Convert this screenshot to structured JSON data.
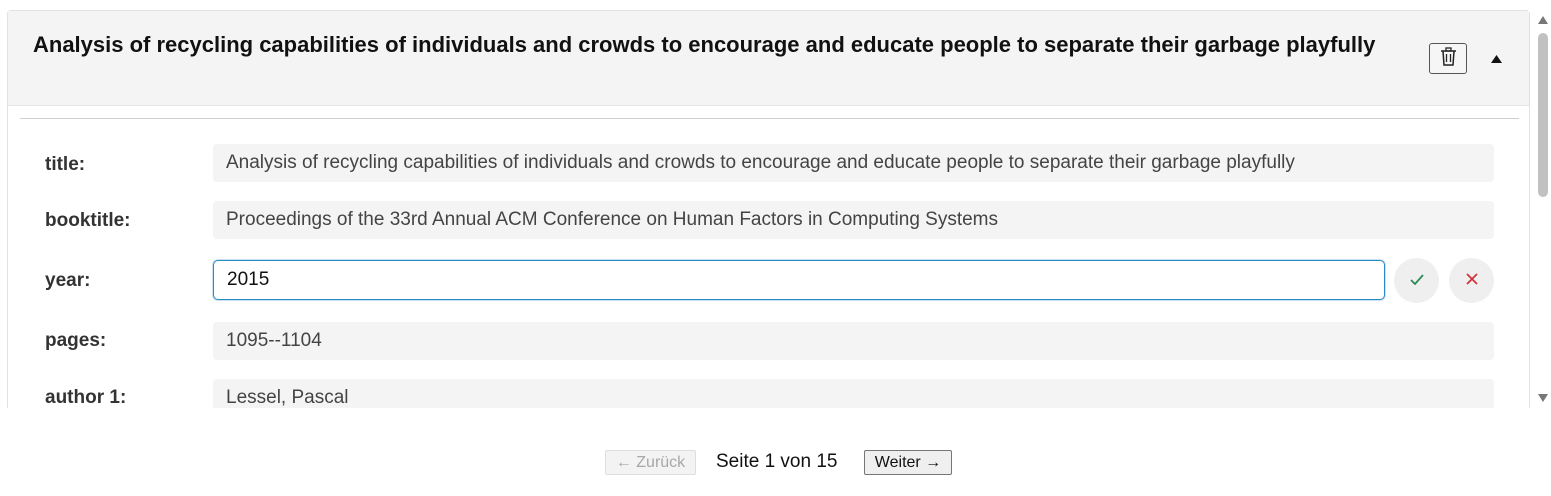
{
  "entry": {
    "title": "Analysis of recycling capabilities of individuals and crowds to encourage and educate people to separate their garbage playfully",
    "delete_icon": "trash-icon",
    "collapse_icon": "triangle-up-icon"
  },
  "fields": {
    "title": {
      "label": "title:",
      "value": "Analysis of recycling capabilities of individuals and crowds to encourage and educate people to separate their garbage playfully"
    },
    "booktitle": {
      "label": "booktitle:",
      "value": "Proceedings of the 33rd Annual ACM Conference on Human Factors in Computing Systems"
    },
    "year": {
      "label": "year:",
      "value": "2015",
      "confirm_icon": "checkmark-icon",
      "cancel_icon": "x-icon"
    },
    "pages": {
      "label": "pages:",
      "value": "1095--1104"
    },
    "author1": {
      "label": "author 1:",
      "value": "Lessel, Pascal"
    }
  },
  "pager": {
    "prev_label": "← Zurück",
    "status": "Seite 1 von 15",
    "next_label": "Weiter →"
  },
  "colors": {
    "accent": "#2a8ac6",
    "confirm": "#2e8b57",
    "cancel": "#d0313d"
  }
}
